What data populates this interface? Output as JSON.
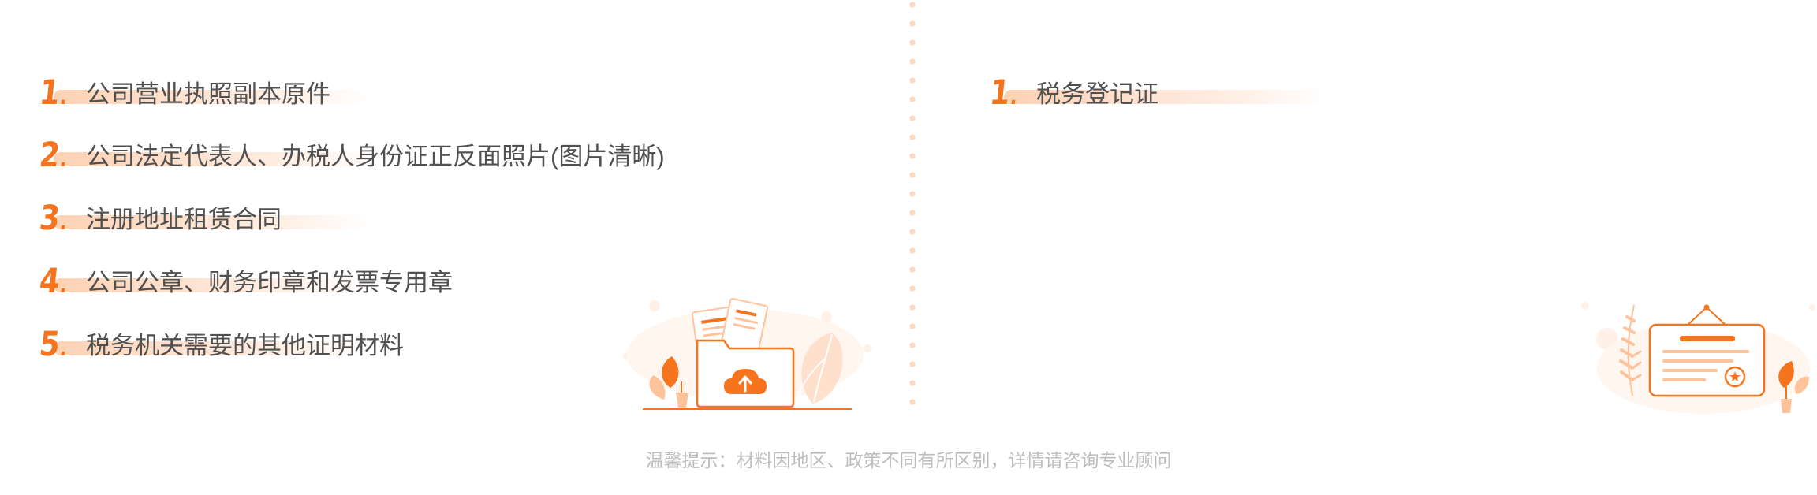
{
  "left_panel": {
    "items": [
      {
        "num": "1",
        "label": "公司营业执照副本原件"
      },
      {
        "num": "2",
        "label": "公司法定代表人、办税人身份证正反面照片(图片清晰)"
      },
      {
        "num": "3",
        "label": "注册地址租赁合同"
      },
      {
        "num": "4",
        "label": "公司公章、财务印章和发票专用章"
      },
      {
        "num": "5",
        "label": "税务机关需要的其他证明材料"
      }
    ],
    "illustration_icon": "folder-upload-icon"
  },
  "right_panel": {
    "items": [
      {
        "num": "1",
        "label": "税务登记证"
      }
    ],
    "illustration_icon": "certificate-icon"
  },
  "item_dot": ".",
  "footer": {
    "tip": "温馨提示：材料因地区、政策不同有所区别，详情请咨询专业顾问"
  },
  "colors": {
    "accent": "#f6741d",
    "highlight": "#fdd2b3",
    "text": "#505050",
    "tip_text": "#bdbdbd",
    "divider_dots": "#ffd7bd"
  }
}
